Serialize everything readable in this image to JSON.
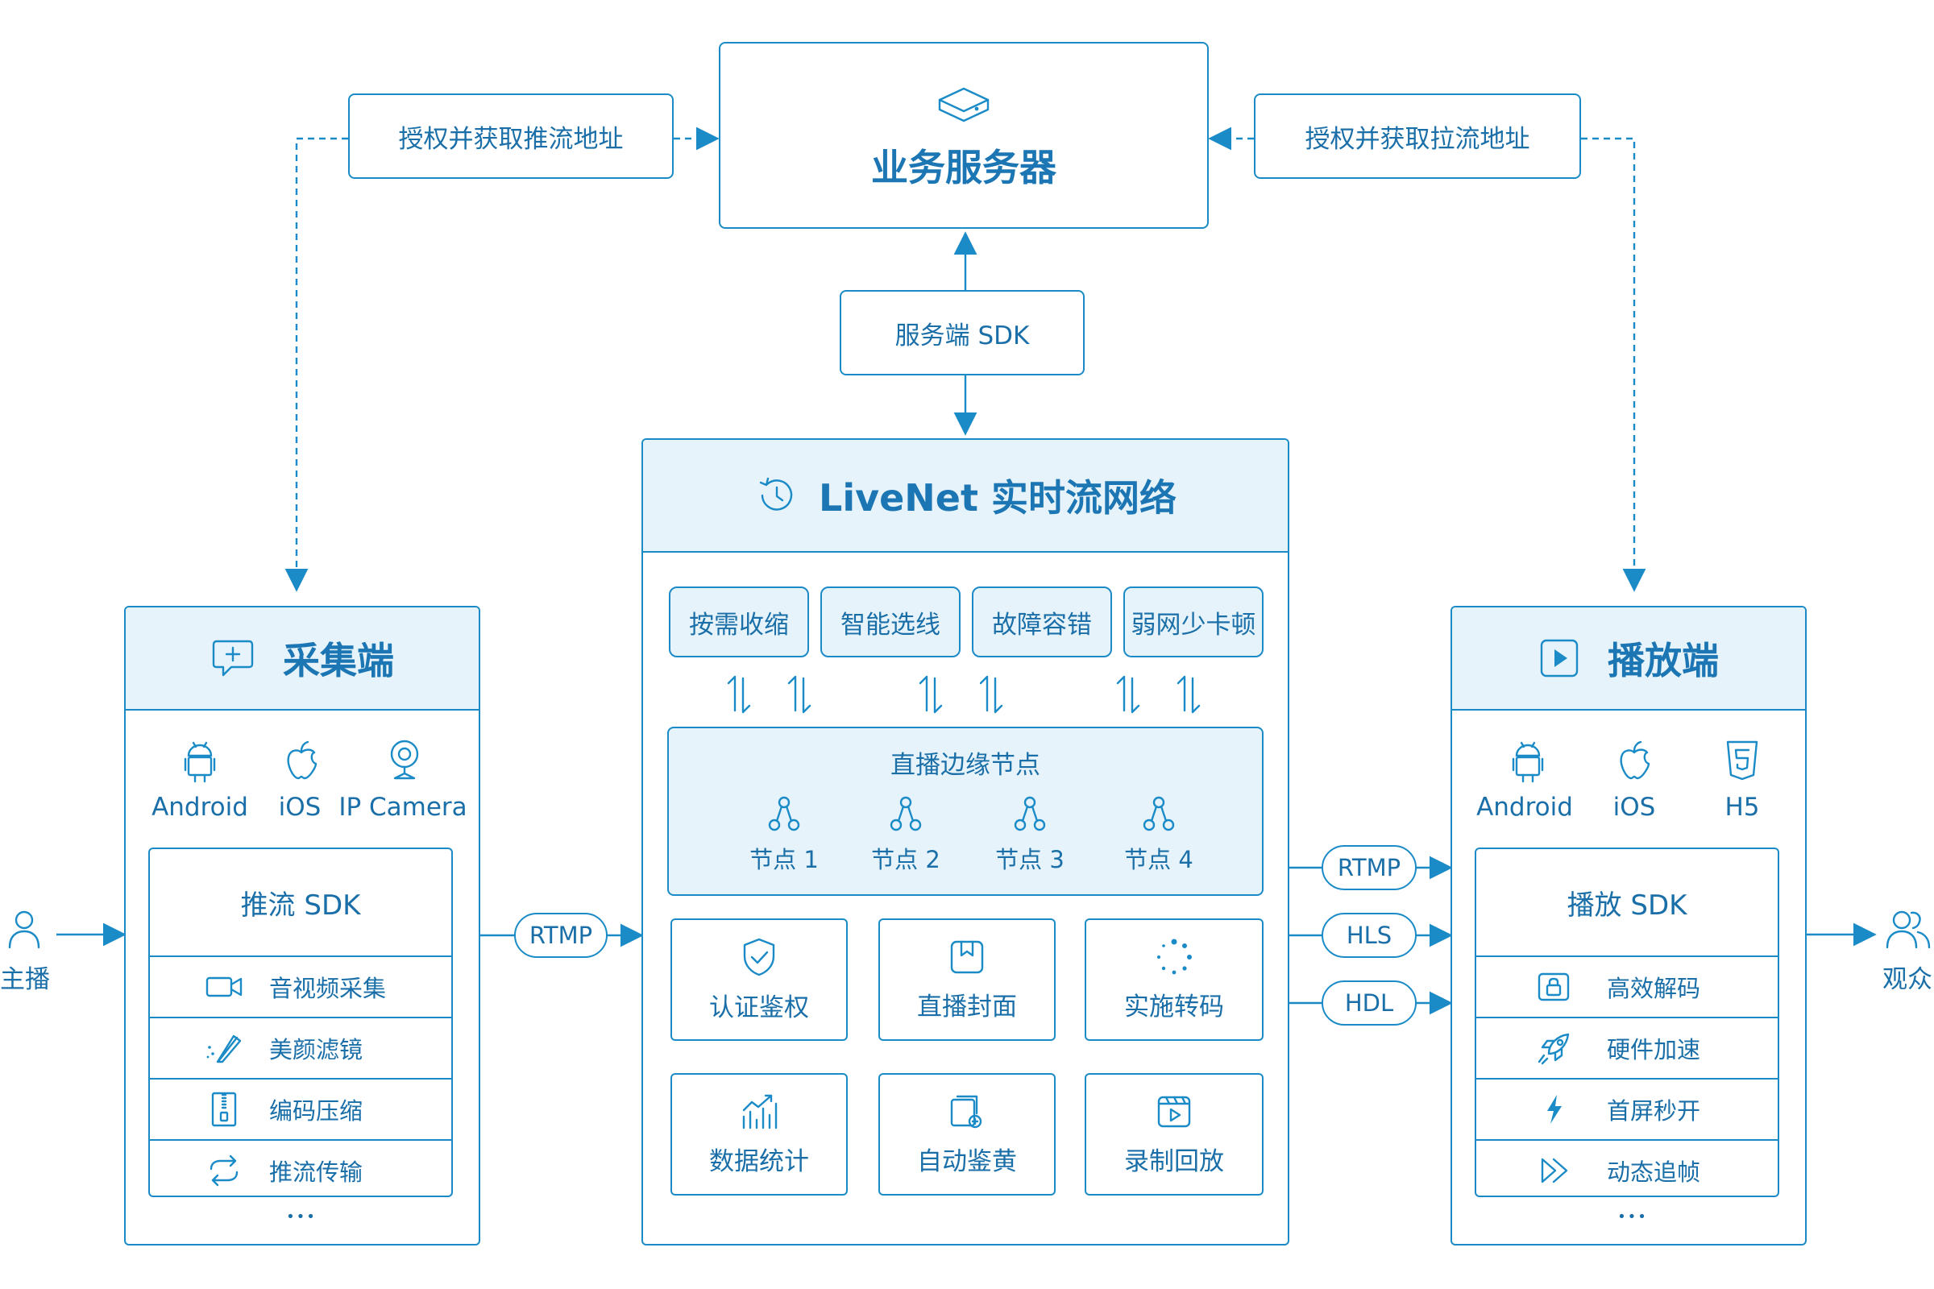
{
  "server": {
    "title": "业务服务器",
    "auth_push_label": "授权并获取推流地址",
    "auth_pull_label": "授权并获取拉流地址",
    "sdk_label": "服务端 SDK"
  },
  "livenet": {
    "title": "LiveNet 实时流网络",
    "features": [
      "按需收缩",
      "智能选线",
      "故障容错",
      "弱网少卡顿"
    ],
    "edge_title": "直播边缘节点",
    "nodes": [
      "节点 1",
      "节点 2",
      "节点 3",
      "节点 4"
    ],
    "services": [
      "认证鉴权",
      "直播封面",
      "实施转码",
      "数据统计",
      "自动鉴黄",
      "录制回放"
    ]
  },
  "capture": {
    "title": "采集端",
    "platforms": [
      "Android",
      "iOS",
      "IP Camera"
    ],
    "sdk_title": "推流 SDK",
    "features": [
      "音视频采集",
      "美颜滤镜",
      "编码压缩",
      "推流传输"
    ],
    "more": "•••"
  },
  "player": {
    "title": "播放端",
    "platforms": [
      "Android",
      "iOS",
      "H5"
    ],
    "sdk_title": "播放 SDK",
    "features": [
      "高效解码",
      "硬件加速",
      "首屏秒开",
      "动态追帧"
    ],
    "more": "•••"
  },
  "protocols": {
    "push": "RTMP",
    "pull": [
      "RTMP",
      "HLS",
      "HDL"
    ]
  },
  "actors": {
    "host": "主播",
    "audience": "观众"
  },
  "accent_color": "#1a8bc7",
  "header_fill": "#e7f3fa"
}
